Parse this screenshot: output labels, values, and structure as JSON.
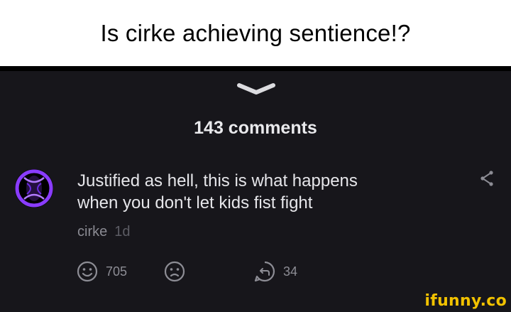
{
  "caption": "Is cirke achieving sentience!?",
  "comments_header": {
    "count_text": "143 comments"
  },
  "comment": {
    "text_line1": "Justified as hell, this is what happens",
    "text_line2": "when you don't let kids fist fight",
    "username": "cirke",
    "age": "1d",
    "smile_count": "705",
    "reply_count": "34"
  },
  "icons": {
    "collapse": "chevron-down-icon",
    "share": "share-icon",
    "smile": "smile-icon",
    "frown": "frown-icon",
    "reply": "reply-icon",
    "avatar": "avatar"
  },
  "watermark": "ifunny.co",
  "colors": {
    "background": "#17161b",
    "text": "#e6e6ea",
    "watermark": "#f2c200",
    "avatar_glow": "#8a3cff"
  }
}
